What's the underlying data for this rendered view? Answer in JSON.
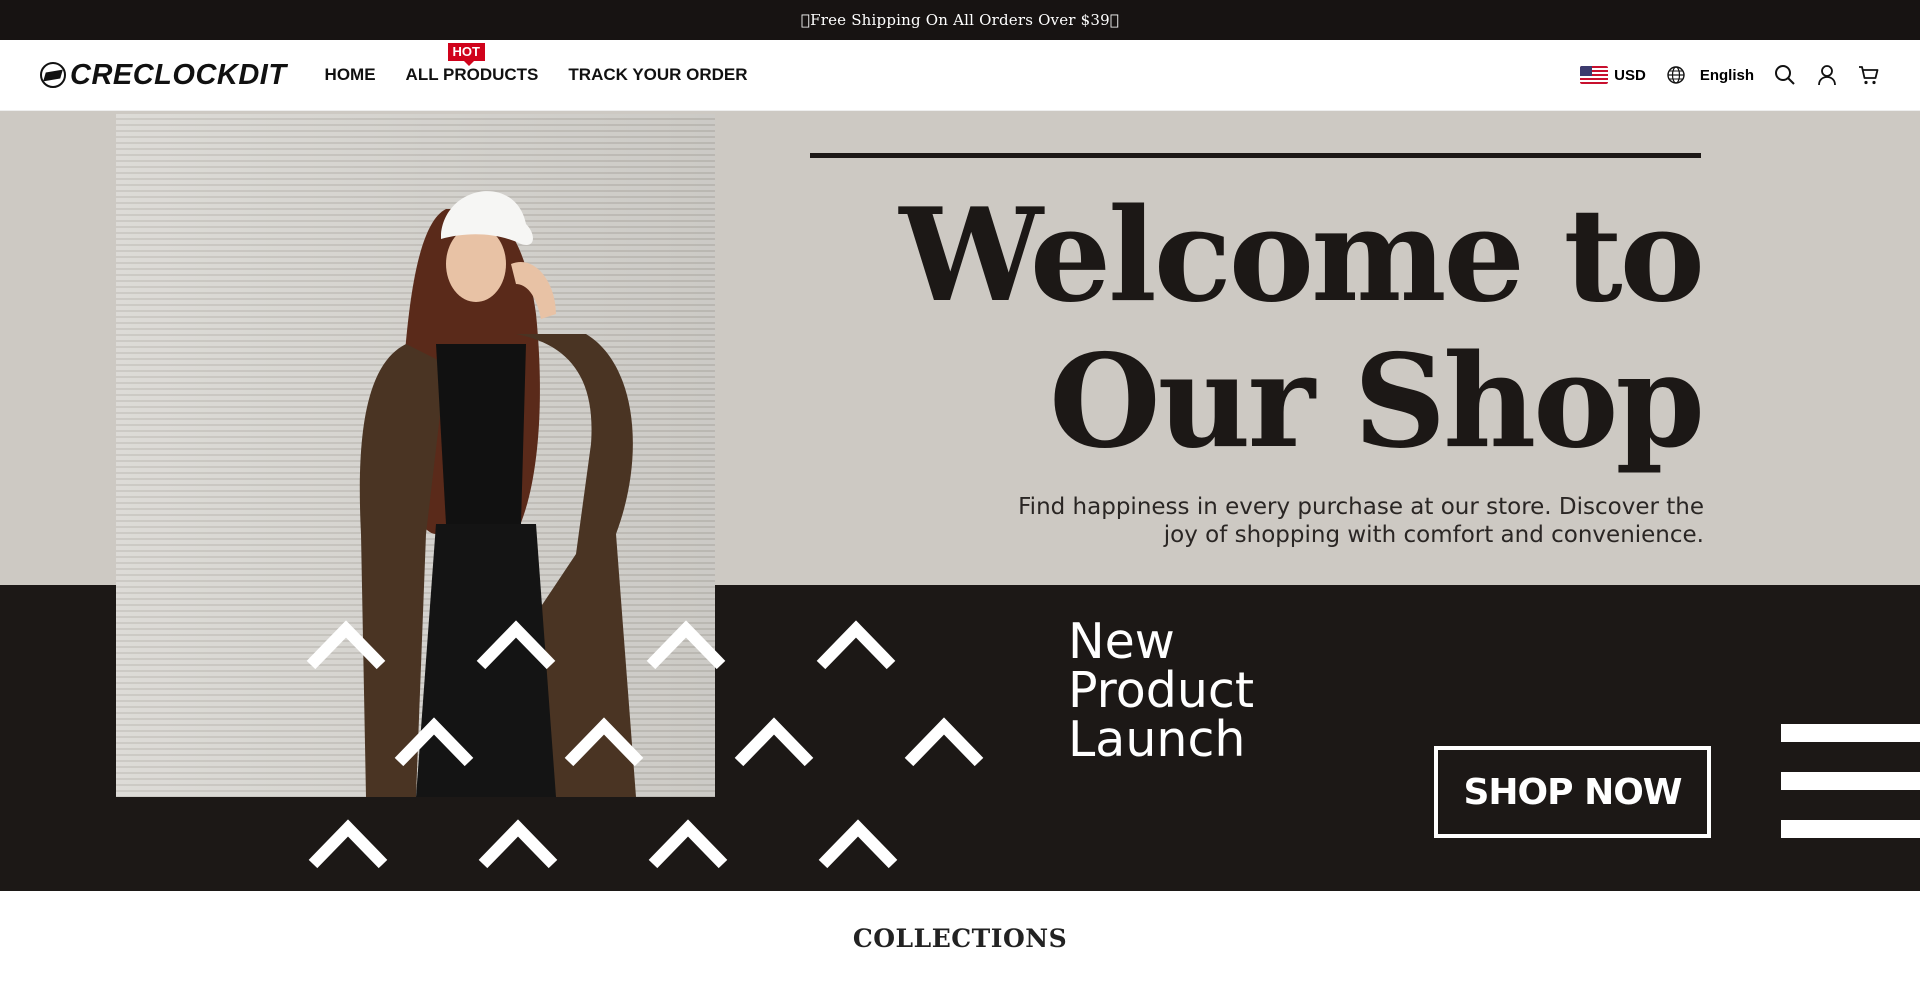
{
  "announcement": {
    "text": "\u0000Free Shipping On All Orders Over $39\u0000"
  },
  "header": {
    "logo_text": "CRECLOCKDIT",
    "nav": [
      {
        "label": "HOME"
      },
      {
        "label": "ALL PRODUCTS",
        "badge": "HOT"
      },
      {
        "label": "TRACK YOUR ORDER"
      }
    ],
    "currency": "USD",
    "language": "English",
    "icons": [
      "us-flag-icon",
      "globe-icon",
      "search-icon",
      "user-icon",
      "cart-icon"
    ]
  },
  "hero": {
    "heading_line1": "Welcome to",
    "heading_line2": "Our Shop",
    "tagline_line1": "Find happiness in every purchase at our store. Discover the",
    "tagline_line2": "joy of shopping with comfort and convenience.",
    "launch_line1": "New",
    "launch_line2": "Product",
    "launch_line3": "Launch",
    "cta_label": "SHOP NOW",
    "colors": {
      "light": "#cdc9c3",
      "dark": "#1c1816",
      "accent": "#d0021b"
    }
  },
  "section": {
    "title": "COLLECTIONS"
  }
}
